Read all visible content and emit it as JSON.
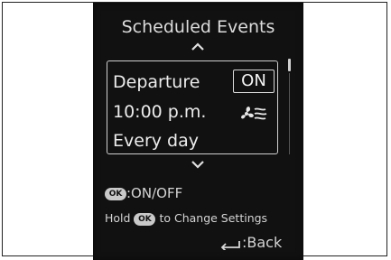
{
  "screen": {
    "title": "Scheduled Events",
    "event": {
      "name": "Departure",
      "time": "10:00 p.m.",
      "repeat": "Every day",
      "toggle_label": "ON",
      "mode_icon": "fan-airflow-icon"
    },
    "hints": {
      "ok_badge": "OK",
      "toggle_hint": ":ON/OFF",
      "hold_prefix": "Hold",
      "hold_suffix": "to Change Settings",
      "back_label": ":Back"
    },
    "colors": {
      "screen_background": "#111111",
      "text": "#e8e8e8"
    }
  }
}
